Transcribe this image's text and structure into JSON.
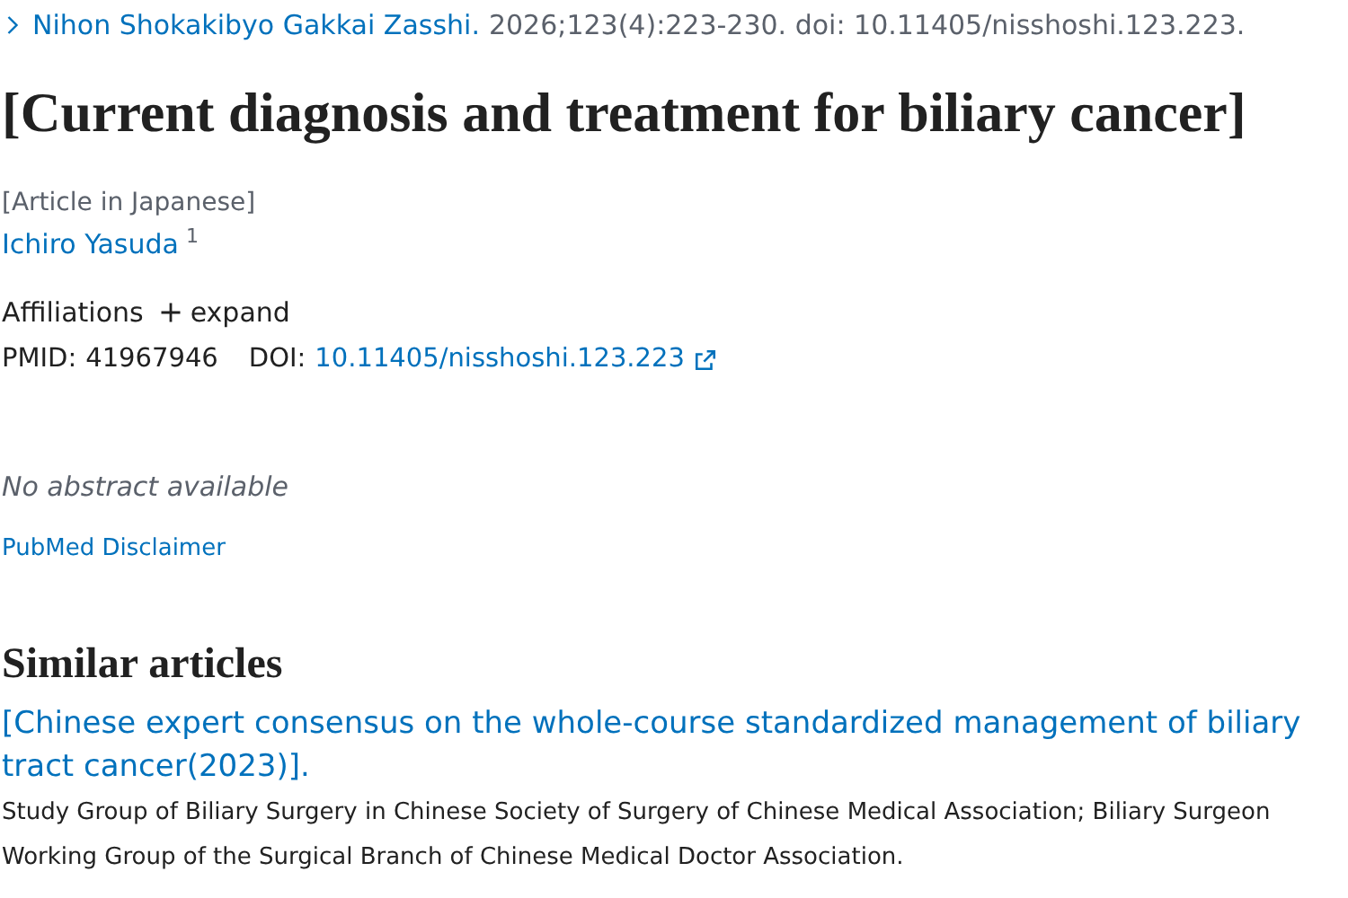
{
  "citation": {
    "journal": "Nihon Shokakibyo Gakkai Zasshi.",
    "details": "2026;123(4):223-230. doi: 10.11405/nisshoshi.123.223."
  },
  "title": "[Current diagnosis and treatment for biliary cancer]",
  "language_note": "[Article in Japanese]",
  "authors": [
    {
      "name": "Ichiro Yasuda",
      "affiliation_ref": "1"
    }
  ],
  "affiliations": {
    "label": "Affiliations",
    "toggle": "expand",
    "expanded": false
  },
  "identifiers": {
    "pmid_label": "PMID:",
    "pmid": "41967946",
    "doi_label": "DOI:",
    "doi": "10.11405/nisshoshi.123.223"
  },
  "abstract_note": "No abstract available",
  "disclaimer_link": "PubMed Disclaimer",
  "similar_articles": {
    "heading": "Similar articles",
    "items": [
      {
        "title": "[Chinese expert consensus on the whole-course standardized management of biliary tract cancer(2023)].",
        "authors": "Study Group of Biliary Surgery in Chinese Society of Surgery of Chinese Medical Association; Biliary Surgeon Working Group of the Surgical Branch of Chinese Medical Doctor Association."
      }
    ]
  }
}
